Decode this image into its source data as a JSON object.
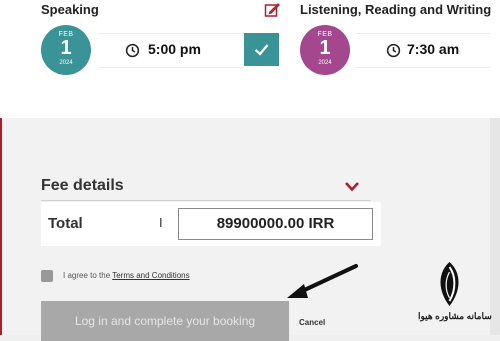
{
  "schedule": {
    "speaking": {
      "title": "Speaking",
      "date": {
        "month": "FEB",
        "day": "1",
        "year": "2024",
        "color": "#3a9497"
      },
      "time": "5:00 pm"
    },
    "lrw": {
      "title": "Listening, Reading and Writing",
      "date": {
        "month": "FEB",
        "day": "1",
        "year": "2024",
        "color": "#a4478e"
      },
      "time": "7:30 am"
    }
  },
  "fee": {
    "title": "Fee details",
    "total_label": "Total",
    "separator": "I",
    "total_value": "89900000.00 IRR"
  },
  "terms": {
    "prefix": "I agree to the ",
    "link": "Terms and Conditions"
  },
  "actions": {
    "login_label": "Log in and complete your booking",
    "cancel_label": "Cancel"
  },
  "watermark": {
    "text": "سامانه مشاوره هیوا"
  },
  "colors": {
    "accent_teal": "#3a9497",
    "accent_purple": "#a4478e",
    "chevron_red": "#b11c2a",
    "button_disabled": "#a8a8a8"
  }
}
